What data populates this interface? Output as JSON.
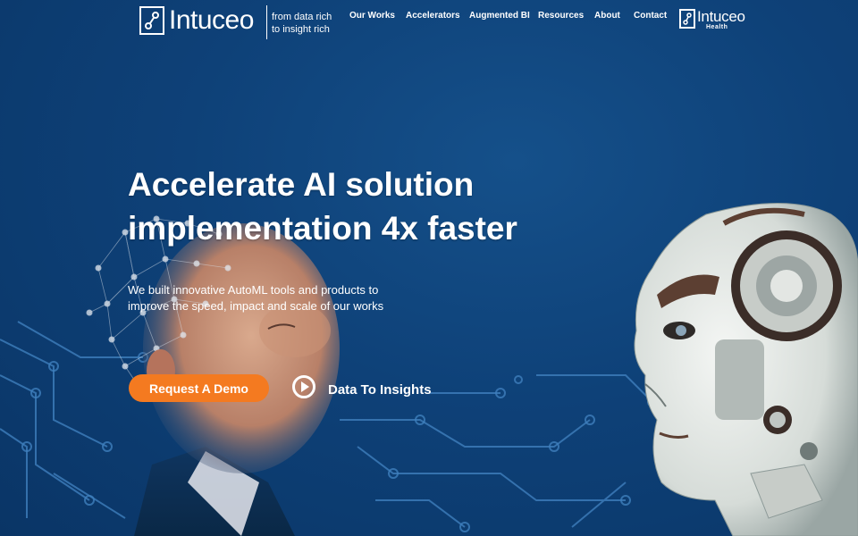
{
  "header": {
    "logo_text": "Intuceo",
    "tagline_line1": "from data rich",
    "tagline_line2": "to insight rich",
    "nav": [
      {
        "label": "Our Works"
      },
      {
        "label": "Accelerators"
      },
      {
        "label": "Augmented BI"
      },
      {
        "label": "Resources"
      },
      {
        "label": "About"
      },
      {
        "label": "Contact"
      }
    ],
    "health_logo_name": "Intuceo",
    "health_logo_sub": "Health"
  },
  "hero": {
    "headline_line1": "Accelerate AI solution",
    "headline_line2": "implementation 4x faster",
    "subtext_line1": "We built innovative AutoML tools and products to",
    "subtext_line2": "improve the speed, impact and scale of our works",
    "demo_button": "Request A Demo",
    "insights_link": "Data To Insights"
  },
  "colors": {
    "background": "#0d3f73",
    "accent": "#f47a20",
    "text": "#ffffff"
  },
  "icons": [
    "logo-icon",
    "health-logo-icon",
    "play-icon"
  ]
}
